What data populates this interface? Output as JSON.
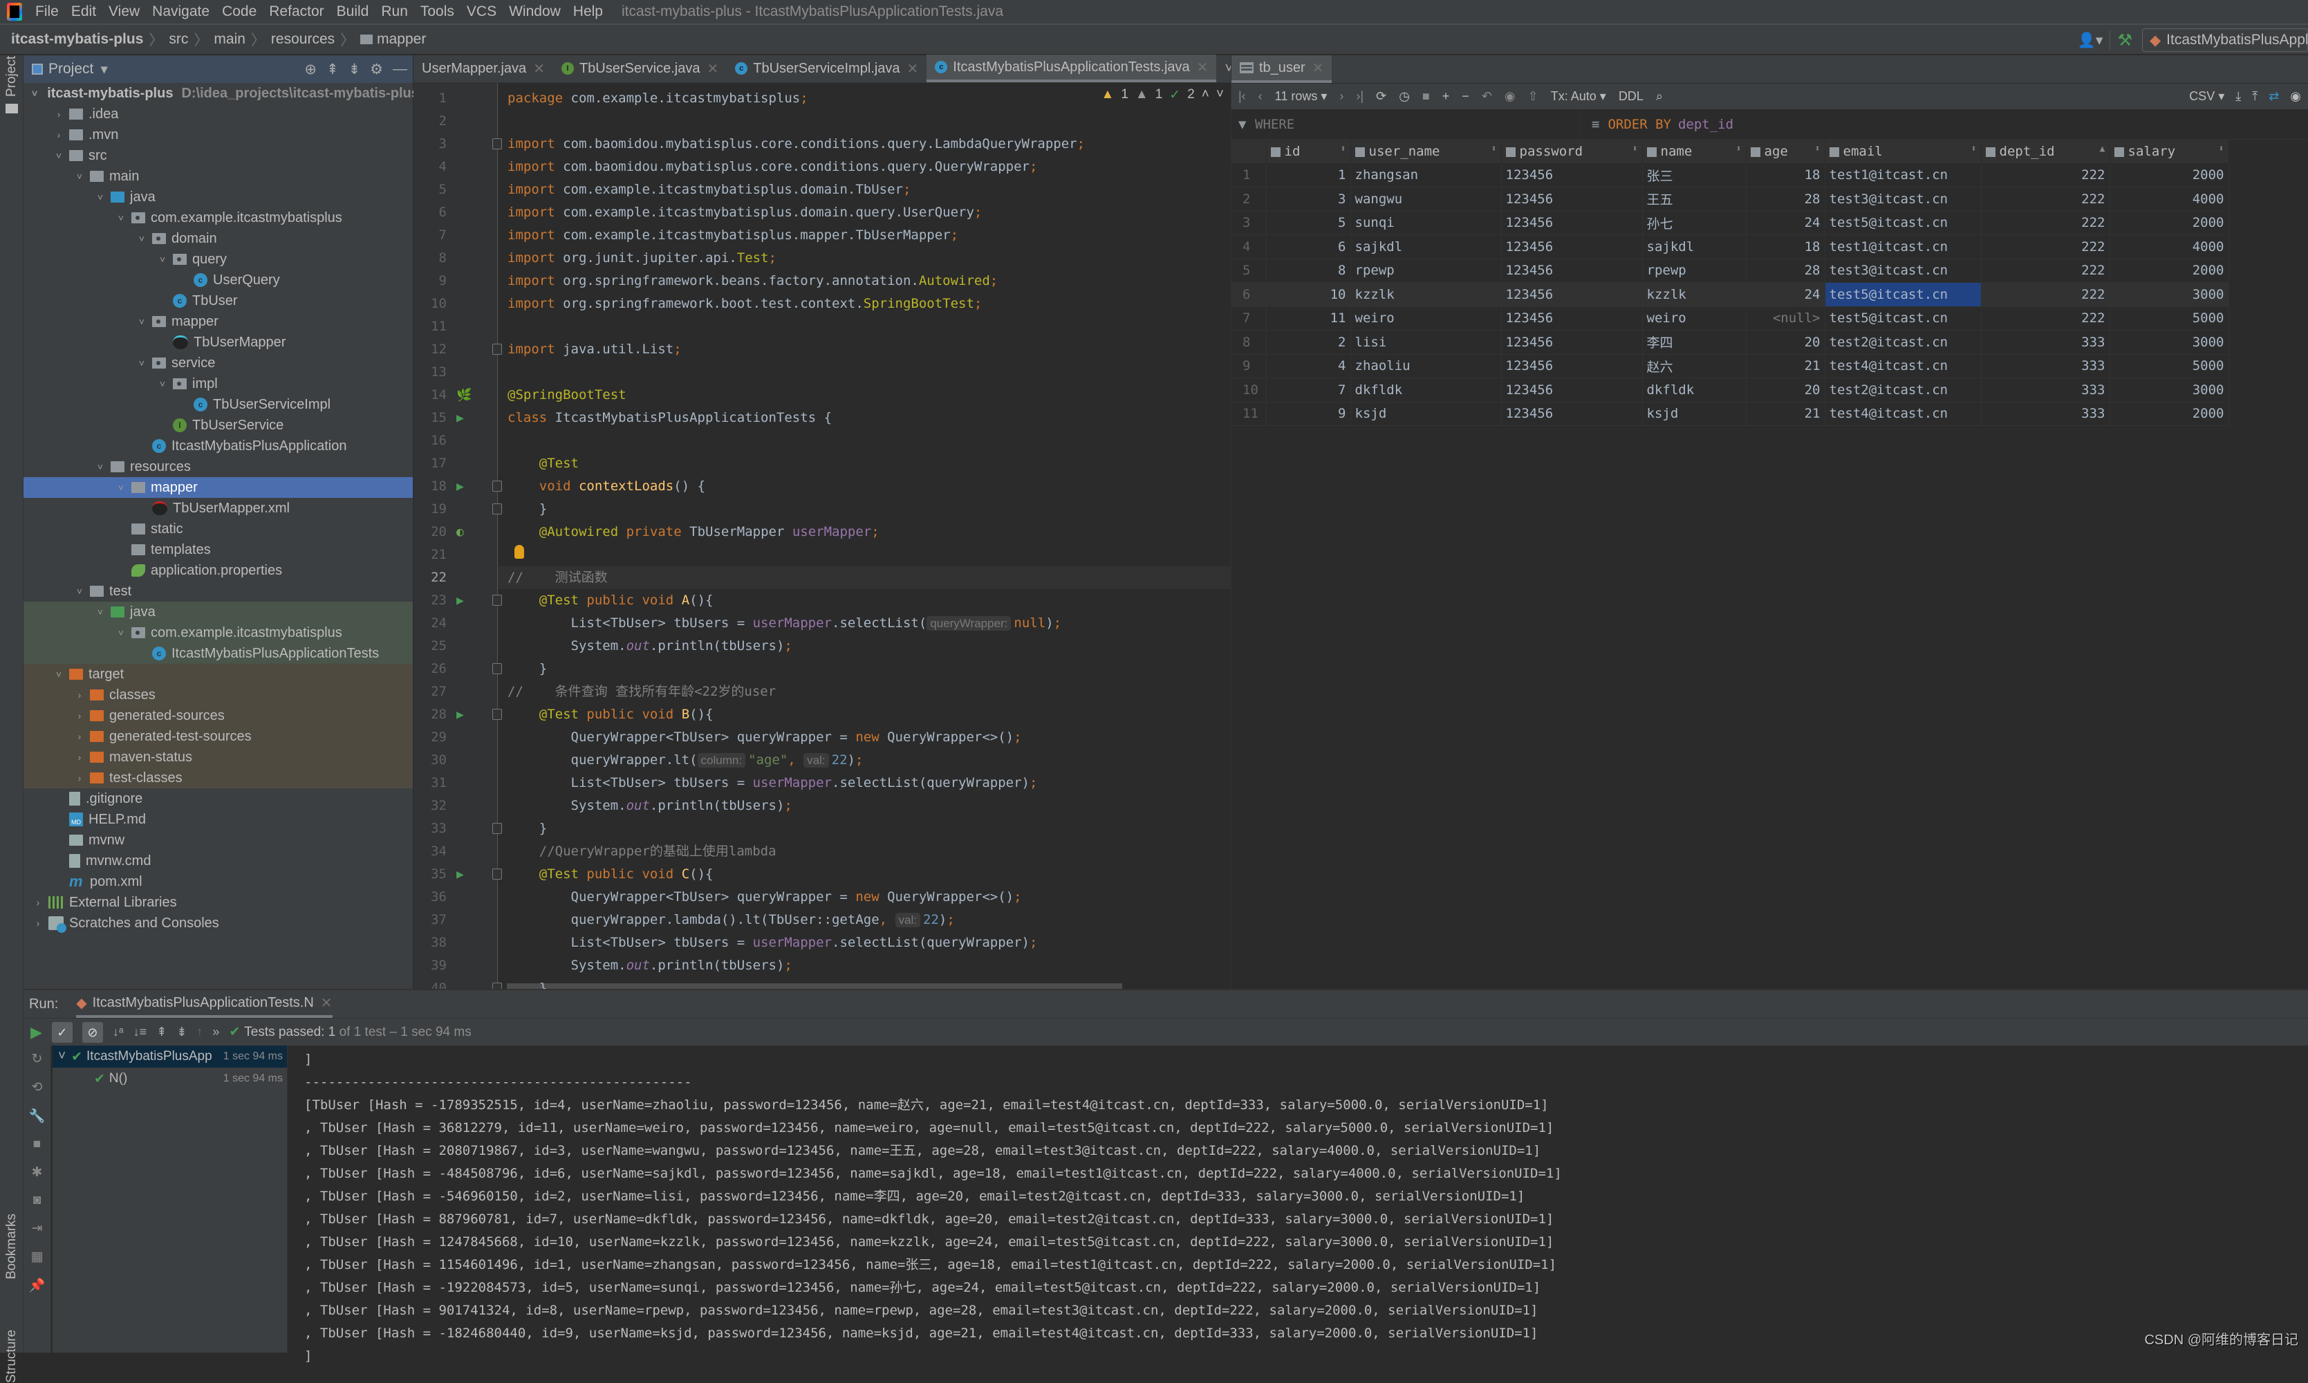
{
  "menubar": {
    "items": [
      "File",
      "Edit",
      "View",
      "Navigate",
      "Code",
      "Refactor",
      "Build",
      "Run",
      "Tools",
      "VCS",
      "Window",
      "Help"
    ],
    "title": "itcast-mybatis-plus - ItcastMybatisPlusApplicationTests.java"
  },
  "navbar": {
    "breadcrumb": [
      "itcast-mybatis-plus",
      "src",
      "main",
      "resources",
      "mapper"
    ],
    "run_config": "ItcastMybatisPlusApplicationTests"
  },
  "leftstrip": {
    "project": "Project",
    "bookmarks": "Bookmarks",
    "structure": "Structure"
  },
  "project": {
    "title": "Project",
    "tree": [
      {
        "label": "itcast-mybatis-plus",
        "path": "D:\\idea_projects\\itcast-mybatis-plus",
        "depth": 0,
        "arrow": "down",
        "icon": "module",
        "bold": true
      },
      {
        "label": ".idea",
        "depth": 1,
        "arrow": "right",
        "icon": "folder"
      },
      {
        "label": ".mvn",
        "depth": 1,
        "arrow": "right",
        "icon": "folder"
      },
      {
        "label": "src",
        "depth": 1,
        "arrow": "down",
        "icon": "folder"
      },
      {
        "label": "main",
        "depth": 2,
        "arrow": "down",
        "icon": "folder"
      },
      {
        "label": "java",
        "depth": 3,
        "arrow": "down",
        "icon": "src"
      },
      {
        "label": "com.example.itcastmybatisplus",
        "depth": 4,
        "arrow": "down",
        "icon": "pkg"
      },
      {
        "label": "domain",
        "depth": 5,
        "arrow": "down",
        "icon": "pkg"
      },
      {
        "label": "query",
        "depth": 6,
        "arrow": "down",
        "icon": "pkg"
      },
      {
        "label": "UserQuery",
        "depth": 7,
        "arrow": "",
        "icon": "cls"
      },
      {
        "label": "TbUser",
        "depth": 6,
        "arrow": "",
        "icon": "cls"
      },
      {
        "label": "mapper",
        "depth": 5,
        "arrow": "down",
        "icon": "pkg"
      },
      {
        "label": "TbUserMapper",
        "depth": 6,
        "arrow": "",
        "icon": "bird"
      },
      {
        "label": "service",
        "depth": 5,
        "arrow": "down",
        "icon": "pkg"
      },
      {
        "label": "impl",
        "depth": 6,
        "arrow": "down",
        "icon": "pkg"
      },
      {
        "label": "TbUserServiceImpl",
        "depth": 7,
        "arrow": "",
        "icon": "cls"
      },
      {
        "label": "TbUserService",
        "depth": 6,
        "arrow": "",
        "icon": "ifc"
      },
      {
        "label": "ItcastMybatisPlusApplication",
        "depth": 5,
        "arrow": "",
        "icon": "cls"
      },
      {
        "label": "resources",
        "depth": 3,
        "arrow": "down",
        "icon": "folder"
      },
      {
        "label": "mapper",
        "depth": 4,
        "arrow": "down",
        "icon": "folder",
        "selected": true
      },
      {
        "label": "TbUserMapper.xml",
        "depth": 5,
        "arrow": "",
        "icon": "birdr"
      },
      {
        "label": "static",
        "depth": 4,
        "arrow": "",
        "icon": "folder"
      },
      {
        "label": "templates",
        "depth": 4,
        "arrow": "",
        "icon": "folder"
      },
      {
        "label": "application.properties",
        "depth": 4,
        "arrow": "",
        "icon": "spring"
      },
      {
        "label": "test",
        "depth": 2,
        "arrow": "down",
        "icon": "folder"
      },
      {
        "label": "java",
        "depth": 3,
        "arrow": "down",
        "icon": "test",
        "bg": "test"
      },
      {
        "label": "com.example.itcastmybatisplus",
        "depth": 4,
        "arrow": "down",
        "icon": "pkg",
        "bg": "test"
      },
      {
        "label": "ItcastMybatisPlusApplicationTests",
        "depth": 5,
        "arrow": "",
        "icon": "cls",
        "bg": "test"
      },
      {
        "label": "target",
        "depth": 1,
        "arrow": "down",
        "icon": "excl",
        "bg": "excl"
      },
      {
        "label": "classes",
        "depth": 2,
        "arrow": "right",
        "icon": "excl",
        "bg": "excl"
      },
      {
        "label": "generated-sources",
        "depth": 2,
        "arrow": "right",
        "icon": "excl",
        "bg": "excl"
      },
      {
        "label": "generated-test-sources",
        "depth": 2,
        "arrow": "right",
        "icon": "excl",
        "bg": "excl"
      },
      {
        "label": "maven-status",
        "depth": 2,
        "arrow": "right",
        "icon": "excl",
        "bg": "excl"
      },
      {
        "label": "test-classes",
        "depth": 2,
        "arrow": "right",
        "icon": "excl",
        "bg": "excl"
      },
      {
        "label": ".gitignore",
        "depth": 1,
        "arrow": "",
        "icon": "file"
      },
      {
        "label": "HELP.md",
        "depth": 1,
        "arrow": "",
        "icon": "md"
      },
      {
        "label": "mvnw",
        "depth": 1,
        "arrow": "",
        "icon": "term"
      },
      {
        "label": "mvnw.cmd",
        "depth": 1,
        "arrow": "",
        "icon": "file"
      },
      {
        "label": "pom.xml",
        "depth": 1,
        "arrow": "",
        "icon": "mvn"
      },
      {
        "label": "External Libraries",
        "depth": 0,
        "arrow": "right",
        "icon": "lib"
      },
      {
        "label": "Scratches and Consoles",
        "depth": 0,
        "arrow": "right",
        "icon": "scr"
      }
    ]
  },
  "editor": {
    "tabs": [
      {
        "label": "UserMapper.java",
        "icon": "bird"
      },
      {
        "label": "TbUserService.java",
        "icon": "interface"
      },
      {
        "label": "TbUserServiceImpl.java",
        "icon": "class"
      },
      {
        "label": "ItcastMybatisPlusApplicationTests.java",
        "icon": "class",
        "active": true
      }
    ],
    "inspections": {
      "warnings": "1",
      "weak_warnings": "1",
      "typos": "2"
    },
    "current_line": 22,
    "lines": [
      [
        [
          "kw",
          "package "
        ],
        [
          "",
          "com.example.itcastmybatisplus"
        ],
        [
          "kw",
          ";"
        ]
      ],
      [],
      [
        [
          "kw",
          "import "
        ],
        [
          "",
          "com.baomidou.mybatisplus.core.conditions.query.LambdaQueryWrapper"
        ],
        [
          "kw",
          ";"
        ]
      ],
      [
        [
          "kw",
          "import "
        ],
        [
          "",
          "com.baomidou.mybatisplus.core.conditions.query.QueryWrapper"
        ],
        [
          "kw",
          ";"
        ]
      ],
      [
        [
          "kw",
          "import "
        ],
        [
          "",
          "com.example.itcastmybatisplus.domain.TbUser"
        ],
        [
          "kw",
          ";"
        ]
      ],
      [
        [
          "kw",
          "import "
        ],
        [
          "",
          "com.example.itcastmybatisplus.domain.query.UserQuery"
        ],
        [
          "kw",
          ";"
        ]
      ],
      [
        [
          "kw",
          "import "
        ],
        [
          "",
          "com.example.itcastmybatisplus.mapper.TbUserMapper"
        ],
        [
          "kw",
          ";"
        ]
      ],
      [
        [
          "kw",
          "import "
        ],
        [
          "",
          "org.junit.jupiter.api."
        ],
        [
          "an",
          "Test"
        ],
        [
          "kw",
          ";"
        ]
      ],
      [
        [
          "kw",
          "import "
        ],
        [
          "",
          "org.springframework.beans.factory.annotation."
        ],
        [
          "an",
          "Autowired"
        ],
        [
          "kw",
          ";"
        ]
      ],
      [
        [
          "kw",
          "import "
        ],
        [
          "",
          "org.springframework.boot.test.context."
        ],
        [
          "an",
          "SpringBootTest"
        ],
        [
          "kw",
          ";"
        ]
      ],
      [],
      [
        [
          "kw",
          "import "
        ],
        [
          "",
          "java.util.List"
        ],
        [
          "kw",
          ";"
        ]
      ],
      [],
      [
        [
          "an",
          "@SpringBootTest"
        ]
      ],
      [
        [
          "kw",
          "class "
        ],
        [
          "",
          "ItcastMybatisPlusApplicationTests {"
        ]
      ],
      [],
      [
        [
          "",
          "    "
        ],
        [
          "an",
          "@Test"
        ]
      ],
      [
        [
          "",
          "    "
        ],
        [
          "kw",
          "void "
        ],
        [
          "fn",
          "contextLoads"
        ],
        [
          "",
          "() {"
        ]
      ],
      [
        [
          "",
          "    }"
        ]
      ],
      [
        [
          "",
          "    "
        ],
        [
          "an",
          "@Autowired "
        ],
        [
          "kw",
          "private "
        ],
        [
          "",
          "TbUserMapper "
        ],
        [
          "fld",
          "userMapper"
        ],
        [
          "kw",
          ";"
        ]
      ],
      [],
      [
        [
          "cm",
          "//    测试函数"
        ]
      ],
      [
        [
          "",
          "    "
        ],
        [
          "an",
          "@Test "
        ],
        [
          "kw",
          "public void "
        ],
        [
          "fn",
          "A"
        ],
        [
          "",
          "(){"
        ]
      ],
      [
        [
          "",
          "        List<TbUser> tbUsers = "
        ],
        [
          "fld",
          "userMapper"
        ],
        [
          "",
          ".selectList("
        ],
        [
          "hint",
          "queryWrapper:"
        ],
        [
          "kw",
          "null"
        ],
        [
          "",
          ")"
        ],
        [
          "kw",
          ";"
        ]
      ],
      [
        [
          "",
          "        System."
        ],
        [
          "it",
          "out"
        ],
        [
          "",
          ".println(tbUsers)"
        ],
        [
          "kw",
          ";"
        ]
      ],
      [
        [
          "",
          "    }"
        ]
      ],
      [
        [
          "cm",
          "//    条件查询 查找所有年龄<22岁的user"
        ]
      ],
      [
        [
          "",
          "    "
        ],
        [
          "an",
          "@Test "
        ],
        [
          "kw",
          "public void "
        ],
        [
          "fn",
          "B"
        ],
        [
          "",
          "(){"
        ]
      ],
      [
        [
          "",
          "        QueryWrapper<TbUser> queryWrapper = "
        ],
        [
          "kw",
          "new "
        ],
        [
          "",
          "QueryWrapper<>()"
        ],
        [
          "kw",
          ";"
        ]
      ],
      [
        [
          "",
          "        queryWrapper.lt("
        ],
        [
          "hint",
          "column:"
        ],
        [
          "str",
          "\"age\""
        ],
        [
          "kw",
          ", "
        ],
        [
          "hint",
          "val:"
        ],
        [
          "num",
          "22"
        ],
        [
          "",
          ")"
        ],
        [
          "kw",
          ";"
        ]
      ],
      [
        [
          "",
          "        List<TbUser> tbUsers = "
        ],
        [
          "fld",
          "userMapper"
        ],
        [
          "",
          ".selectList(queryWrapper)"
        ],
        [
          "kw",
          ";"
        ]
      ],
      [
        [
          "",
          "        System."
        ],
        [
          "it",
          "out"
        ],
        [
          "",
          ".println(tbUsers)"
        ],
        [
          "kw",
          ";"
        ]
      ],
      [
        [
          "",
          "    }"
        ]
      ],
      [
        [
          "cm",
          "    //QueryWrapper的基础上使用lambda"
        ]
      ],
      [
        [
          "",
          "    "
        ],
        [
          "an",
          "@Test "
        ],
        [
          "kw",
          "public void "
        ],
        [
          "fn",
          "C"
        ],
        [
          "",
          "(){"
        ]
      ],
      [
        [
          "",
          "        QueryWrapper<TbUser> queryWrapper = "
        ],
        [
          "kw",
          "new "
        ],
        [
          "",
          "QueryWrapper<>()"
        ],
        [
          "kw",
          ";"
        ]
      ],
      [
        [
          "",
          "        queryWrapper.lambda().lt(TbUser::getAge"
        ],
        [
          "kw",
          ", "
        ],
        [
          "hint",
          "val:"
        ],
        [
          "num",
          "22"
        ],
        [
          "",
          ")"
        ],
        [
          "kw",
          ";"
        ]
      ],
      [
        [
          "",
          "        List<TbUser> tbUsers = "
        ],
        [
          "fld",
          "userMapper"
        ],
        [
          "",
          ".selectList(queryWrapper)"
        ],
        [
          "kw",
          ";"
        ]
      ],
      [
        [
          "",
          "        System."
        ],
        [
          "it",
          "out"
        ],
        [
          "",
          ".println(tbUsers)"
        ],
        [
          "kw",
          ";"
        ]
      ],
      [
        [
          "",
          "    }"
        ]
      ]
    ]
  },
  "db": {
    "tab": "tb_user",
    "rows_label": "11 rows",
    "tx": "Tx: Auto",
    "ddl": "DDL",
    "export_format": "CSV",
    "where_placeholder": "WHERE",
    "order_by_kw": "ORDER BY",
    "order_by_col": "dept_id",
    "columns": [
      "id",
      "user_name",
      "password",
      "name",
      "age",
      "email",
      "dept_id",
      "salary"
    ],
    "sorted_column": "dept_id",
    "sort_direction": "asc",
    "rows": [
      [
        "1",
        "zhangsan",
        "123456",
        "张三",
        "18",
        "test1@itcast.cn",
        "222",
        "2000"
      ],
      [
        "3",
        "wangwu",
        "123456",
        "王五",
        "28",
        "test3@itcast.cn",
        "222",
        "4000"
      ],
      [
        "5",
        "sunqi",
        "123456",
        "孙七",
        "24",
        "test5@itcast.cn",
        "222",
        "2000"
      ],
      [
        "6",
        "sajkdl",
        "123456",
        "sajkdl",
        "18",
        "test1@itcast.cn",
        "222",
        "4000"
      ],
      [
        "8",
        "rpewp",
        "123456",
        "rpewp",
        "28",
        "test3@itcast.cn",
        "222",
        "2000"
      ],
      [
        "10",
        "kzzlk",
        "123456",
        "kzzlk",
        "24",
        "test5@itcast.cn",
        "222",
        "3000"
      ],
      [
        "11",
        "weiro",
        "123456",
        "weiro",
        "<null>",
        "test5@itcast.cn",
        "222",
        "5000"
      ],
      [
        "2",
        "lisi",
        "123456",
        "李四",
        "20",
        "test2@itcast.cn",
        "333",
        "3000"
      ],
      [
        "4",
        "zhaoliu",
        "123456",
        "赵六",
        "21",
        "test4@itcast.cn",
        "333",
        "5000"
      ],
      [
        "7",
        "dkfldk",
        "123456",
        "dkfldk",
        "20",
        "test2@itcast.cn",
        "333",
        "3000"
      ],
      [
        "9",
        "ksjd",
        "123456",
        "ksjd",
        "21",
        "test4@itcast.cn",
        "333",
        "2000"
      ]
    ],
    "selected_row": 6,
    "selected_col": "email"
  },
  "run": {
    "label": "Run:",
    "tab": "ItcastMybatisPlusApplicationTests.N",
    "status_prefix": "Tests passed:",
    "status_count": "1",
    "status_rest": "of 1 test – 1 sec 94 ms",
    "tree": [
      {
        "label": "ItcastMybatisPlusApp",
        "time": "1 sec 94 ms"
      },
      {
        "label": "N()",
        "time": "1 sec 94 ms"
      }
    ],
    "console": [
      "]",
      "-------------------------------------------------",
      "[TbUser [Hash = -1789352515, id=4, userName=zhaoliu, password=123456, name=赵六, age=21, email=test4@itcast.cn, deptId=333, salary=5000.0, serialVersionUID=1]",
      ", TbUser [Hash = 36812279, id=11, userName=weiro, password=123456, name=weiro, age=null, email=test5@itcast.cn, deptId=222, salary=5000.0, serialVersionUID=1]",
      ", TbUser [Hash = 2080719867, id=3, userName=wangwu, password=123456, name=王五, age=28, email=test3@itcast.cn, deptId=222, salary=4000.0, serialVersionUID=1]",
      ", TbUser [Hash = -484508796, id=6, userName=sajkdl, password=123456, name=sajkdl, age=18, email=test1@itcast.cn, deptId=222, salary=4000.0, serialVersionUID=1]",
      ", TbUser [Hash = -546960150, id=2, userName=lisi, password=123456, name=李四, age=20, email=test2@itcast.cn, deptId=333, salary=3000.0, serialVersionUID=1]",
      ", TbUser [Hash = 887960781, id=7, userName=dkfldk, password=123456, name=dkfldk, age=20, email=test2@itcast.cn, deptId=333, salary=3000.0, serialVersionUID=1]",
      ", TbUser [Hash = 1247845668, id=10, userName=kzzlk, password=123456, name=kzzlk, age=24, email=test5@itcast.cn, deptId=222, salary=3000.0, serialVersionUID=1]",
      ", TbUser [Hash = 1154601496, id=1, userName=zhangsan, password=123456, name=张三, age=18, email=test1@itcast.cn, deptId=222, salary=2000.0, serialVersionUID=1]",
      ", TbUser [Hash = -1922084573, id=5, userName=sunqi, password=123456, name=孙七, age=24, email=test5@itcast.cn, deptId=222, salary=2000.0, serialVersionUID=1]",
      ", TbUser [Hash = 901741324, id=8, userName=rpewp, password=123456, name=rpewp, age=28, email=test3@itcast.cn, deptId=222, salary=2000.0, serialVersionUID=1]",
      ", TbUser [Hash = -1824680440, id=9, userName=ksjd, password=123456, name=ksjd, age=21, email=test4@itcast.cn, deptId=333, salary=2000.0, serialVersionUID=1]",
      "]"
    ]
  },
  "watermark": "CSDN @阿维的博客日记"
}
